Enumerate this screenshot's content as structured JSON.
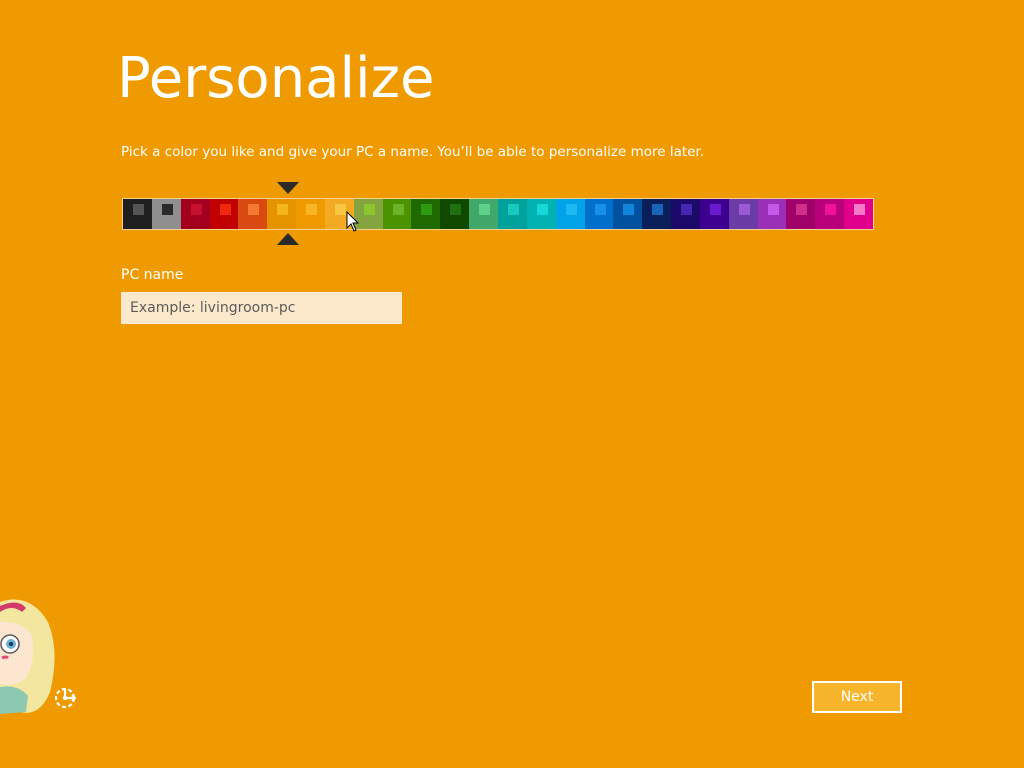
{
  "header": {
    "title": "Personalize"
  },
  "instructions": {
    "text": "Pick a color you like and give your PC a name. You’ll be able to personalize more later."
  },
  "palette": {
    "selected_index": 6,
    "swatches": [
      {
        "bg": "#1F1F1F",
        "chip": "#555555"
      },
      {
        "bg": "#8F8F8F",
        "chip": "#2A2A2A"
      },
      {
        "bg": "#A2001E",
        "chip": "#C7102E"
      },
      {
        "bg": "#C10000",
        "chip": "#F0280F"
      },
      {
        "bg": "#D84A0F",
        "chip": "#F47A32"
      },
      {
        "bg": "#E59400",
        "chip": "#F7B51C"
      },
      {
        "bg": "#EE9A00",
        "chip": "#F8B524"
      },
      {
        "bg": "#F4A922",
        "chip": "#F8C640"
      },
      {
        "bg": "#84A440",
        "chip": "#8CC62E"
      },
      {
        "bg": "#4B9400",
        "chip": "#6BB42A"
      },
      {
        "bg": "#1E6A00",
        "chip": "#2F9A10"
      },
      {
        "bg": "#0F4A00",
        "chip": "#1F7010"
      },
      {
        "bg": "#3FA86A",
        "chip": "#5FD08A"
      },
      {
        "bg": "#00A19A",
        "chip": "#18C9C0"
      },
      {
        "bg": "#00B2B2",
        "chip": "#16D8D8"
      },
      {
        "bg": "#00A2E8",
        "chip": "#1CB8F2"
      },
      {
        "bg": "#006FCC",
        "chip": "#1690E8"
      },
      {
        "bg": "#00519E",
        "chip": "#0F86DC"
      },
      {
        "bg": "#0A1E5A",
        "chip": "#1A64B8"
      },
      {
        "bg": "#1C0A6A",
        "chip": "#4626B0"
      },
      {
        "bg": "#3D008F",
        "chip": "#6C1AD0"
      },
      {
        "bg": "#6B3BA6",
        "chip": "#9A5AD6"
      },
      {
        "bg": "#9A2FB8",
        "chip": "#C65AE8"
      },
      {
        "bg": "#A0006A",
        "chip": "#D0308A"
      },
      {
        "bg": "#B8007A",
        "chip": "#F0109A"
      },
      {
        "bg": "#E0008C",
        "chip": "#F57AC8"
      }
    ]
  },
  "pc_name": {
    "label": "PC name",
    "placeholder": "Example: livingroom-pc",
    "value": ""
  },
  "footer": {
    "next_label": "Next"
  },
  "colors": {
    "background": "#EE9A00",
    "marker": "#2A2A2A",
    "input_bg": "#FCE9CC",
    "next_bg": "#F7B52C"
  },
  "icons": {
    "accessibility": "ease-of-access-icon",
    "cursor": "mouse-pointer-icon",
    "mascot": "cartoon-character-icon"
  }
}
